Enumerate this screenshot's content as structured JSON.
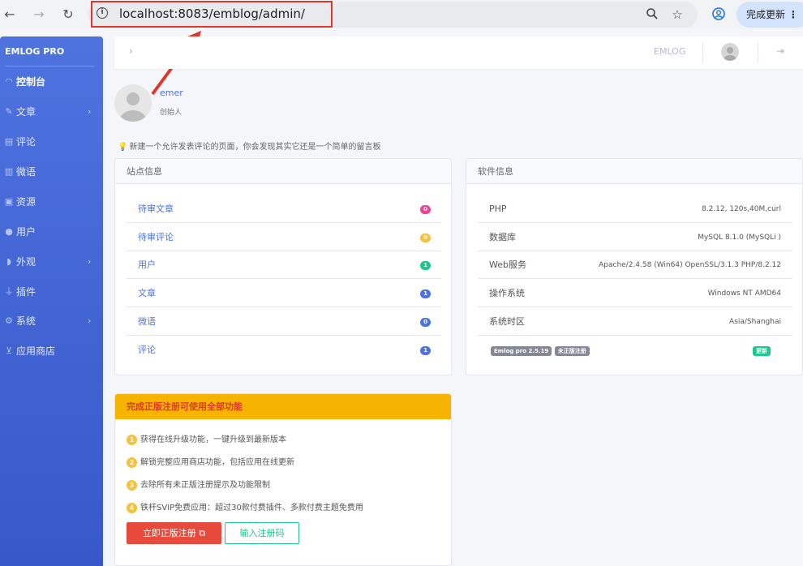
{
  "browser": {
    "url": "localhost:8083/emblog/admin/",
    "update_label": "完成更新"
  },
  "sidebar": {
    "brand": "EMLOG PRO",
    "items": [
      {
        "label": "控制台",
        "icon": "dashboard-icon",
        "active": true,
        "has_children": false
      },
      {
        "label": "文章",
        "icon": "pencil-icon",
        "has_children": true
      },
      {
        "label": "评论",
        "icon": "comment-icon",
        "has_children": false
      },
      {
        "label": "微语",
        "icon": "note-icon",
        "has_children": false
      },
      {
        "label": "资源",
        "icon": "image-icon",
        "has_children": false
      },
      {
        "label": "用户",
        "icon": "user-icon",
        "has_children": false
      },
      {
        "label": "外观",
        "icon": "palette-icon",
        "has_children": true
      },
      {
        "label": "插件",
        "icon": "plug-icon",
        "has_children": false
      },
      {
        "label": "系统",
        "icon": "gear-icon",
        "has_children": true
      },
      {
        "label": "应用商店",
        "icon": "cart-icon",
        "has_children": false
      }
    ]
  },
  "topbar": {
    "brand": "EMLOG"
  },
  "profile": {
    "name": "emer",
    "role": "创始人"
  },
  "tip": "新建一个允许发表评论的页面，你会发现其实它还是一个简单的留言板",
  "site_info": {
    "title": "站点信息",
    "rows": [
      {
        "label": "待审文章",
        "count": "0",
        "color": "#e74694"
      },
      {
        "label": "待审评论",
        "count": "0",
        "color": "#f6c23e"
      },
      {
        "label": "用户",
        "count": "1",
        "color": "#1cc88a"
      },
      {
        "label": "文章",
        "count": "1",
        "color": "#4e73df"
      },
      {
        "label": "微语",
        "count": "0",
        "color": "#4e73df"
      },
      {
        "label": "评论",
        "count": "1",
        "color": "#4e73df"
      }
    ]
  },
  "software_info": {
    "title": "软件信息",
    "rows": [
      {
        "label": "PHP",
        "value": "8.2.12, 120s,40M,curl"
      },
      {
        "label": "数据库",
        "value": "MySQL 8.1.0 (MySQLi )"
      },
      {
        "label": "Web服务",
        "value": "Apache/2.4.58 (Win64) OpenSSL/3.1.3 PHP/8.2.12"
      },
      {
        "label": "操作系统",
        "value": "Windows NT AMD64"
      },
      {
        "label": "系统时区",
        "value": "Asia/Shanghai"
      }
    ],
    "version_badge": "Emlog pro 2.5.19",
    "unregistered_badge": "未正版注册",
    "update_badge": "更新"
  },
  "register": {
    "title": "完成正版注册可使用全部功能",
    "items": [
      {
        "num": "1",
        "text": "获得在线升级功能，一键升级到最新版本"
      },
      {
        "num": "2",
        "text": "解锁完整应用商店功能，包括应用在线更新"
      },
      {
        "num": "3",
        "text": "去除所有未正版注册提示及功能限制"
      },
      {
        "num": "4",
        "text": "铁杆SVIP免费应用：超过30款付费插件、多款付费主题免费用"
      }
    ],
    "primary_button": "立即正版注册",
    "secondary_button": "输入注册码"
  }
}
